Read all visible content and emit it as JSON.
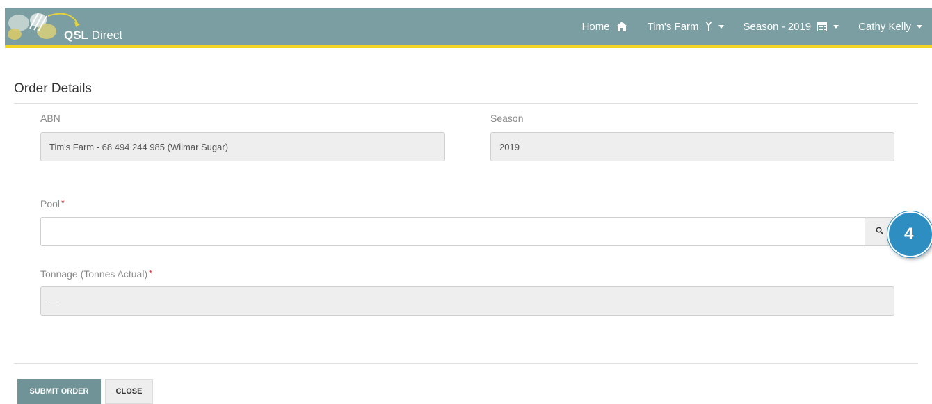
{
  "colors": {
    "navbar_bg": "#7a9ea1",
    "navbar_accent": "#f2d622",
    "primary_button": "#6f9397",
    "callout": "#2e8ec2",
    "required": "#d9262d"
  },
  "header": {
    "logo_brand": "QSL",
    "logo_suffix": "Direct",
    "nav": {
      "home": "Home",
      "farm": "Tim's Farm",
      "season": "Season - 2019",
      "user": "Cathy Kelly"
    },
    "icons": {
      "home": "home-icon",
      "farm": "farm-icon",
      "season": "calendar-icon"
    }
  },
  "form": {
    "title": "Order Details",
    "abn": {
      "label": "ABN",
      "value": "Tim's Farm - 68 494 244 985 (Wilmar Sugar)"
    },
    "season": {
      "label": "Season",
      "value": "2019"
    },
    "pool": {
      "label": "Pool",
      "required_marker": "*",
      "value": ""
    },
    "tonnage": {
      "label": "Tonnage (Tonnes Actual)",
      "required_marker": "*",
      "value": "—"
    }
  },
  "callout": {
    "number": "4"
  },
  "buttons": {
    "submit": "SUBMIT ORDER",
    "close": "CLOSE"
  }
}
